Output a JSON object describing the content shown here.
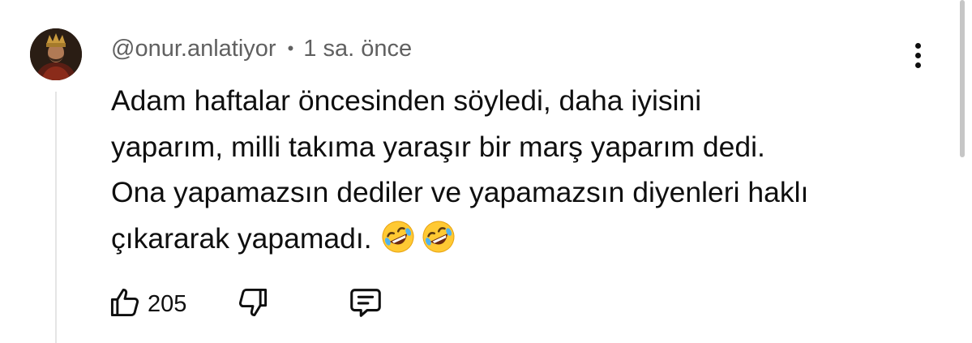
{
  "comment": {
    "author": "@onur.anlatiyor",
    "separator": "•",
    "time": "1 sa. önce",
    "text_lines": [
      "Adam haftalar öncesinden söyledi, daha iyisini",
      "yaparım, milli takıma yaraşır bir marş yaparım dedi.",
      "Ona yapamazsın dediler ve yapamazsın diyenleri haklı",
      "çıkararak yapamadı."
    ],
    "emojis": [
      "rolling-on-floor-laughing-emoji",
      "rolling-on-floor-laughing-emoji"
    ],
    "like_count": "205"
  },
  "icons": {
    "like": "thumbs-up-icon",
    "dislike": "thumbs-down-icon",
    "reply": "reply-comment-icon",
    "more": "more-vert-icon"
  },
  "colors": {
    "text": "#0f0f0f",
    "meta_text": "#606060",
    "thread_line": "#e5e5e5",
    "emoji_face": "#ffc933"
  }
}
